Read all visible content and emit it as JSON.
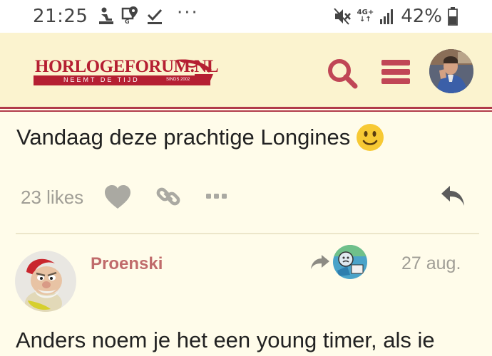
{
  "status_bar": {
    "time": "21:25",
    "overflow_dots": "···",
    "network_label_top": "4G+",
    "network_label_bottom": "↓↑",
    "battery_percent": "42%",
    "left_icons": [
      "person-rowing-icon",
      "map-pin-icon",
      "check-icon"
    ],
    "right_icons": [
      "mute-icon",
      "signal-icon",
      "battery-icon"
    ]
  },
  "header": {
    "logo": {
      "name": "HORLOGEFORUM.NL",
      "tagline": "NEEMT DE TIJD",
      "since": "SINDS 2002"
    },
    "icons": [
      "search-icon",
      "hamburger-menu-icon"
    ],
    "accent_color": "#c04656",
    "background_color": "#fbf3cf"
  },
  "post_1": {
    "text": "Vandaag deze prachtige Longines",
    "emoji": "slightly-smiling-face",
    "likes": "23 likes",
    "actions": [
      "like-heart-icon",
      "link-icon",
      "more-dots-icon",
      "reply-icon"
    ]
  },
  "post_2": {
    "username": "Proenski",
    "date": "27 aug.",
    "body": "Anders noem je het een young timer, als ie",
    "username_color": "#c06b6b"
  },
  "colors": {
    "page_background": "#fffcea",
    "muted_text": "#a09e96",
    "brand_red": "#b51f32"
  }
}
